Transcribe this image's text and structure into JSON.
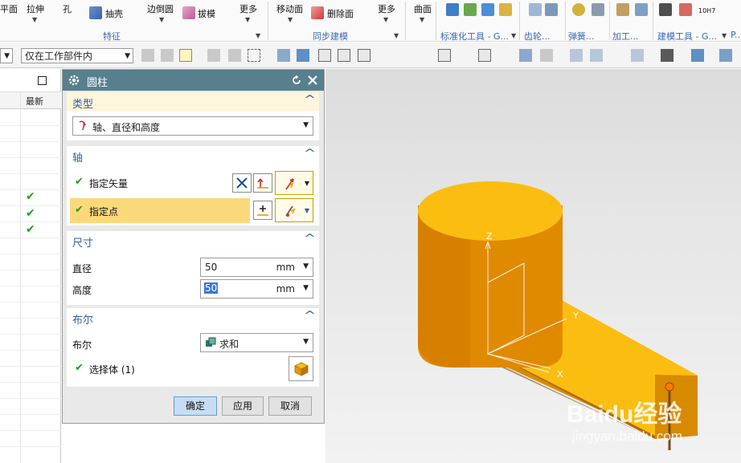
{
  "ribbon": {
    "items": [
      {
        "label": "平面"
      },
      {
        "label": "拉伸"
      },
      {
        "label": "孔"
      },
      {
        "label": "抽壳"
      },
      {
        "label": "边倒圆"
      },
      {
        "label": "拔模"
      },
      {
        "label": "更多"
      },
      {
        "label": "移动面"
      },
      {
        "label": "删除面"
      },
      {
        "label": "更多"
      },
      {
        "label": "曲面"
      }
    ],
    "groups": {
      "feature": "特征",
      "sync": "同步建模",
      "std_tools": "标准化工具 - G...",
      "gear": "齿轮...",
      "spring": "弹簧...",
      "machining": "加工...",
      "build_tools": "建模工具 - G...",
      "more": "P..."
    },
    "tolerance_icon_text": "10H7"
  },
  "toolbar2": {
    "scope_select": "仅在工作部件内"
  },
  "navigator": {
    "column_header": "最新",
    "checks": [
      "✔",
      "✔",
      "✔"
    ]
  },
  "dialog": {
    "title": "圆柱",
    "type_section": {
      "title": "类型",
      "selected_type": "轴、直径和高度"
    },
    "axis_section": {
      "title": "轴",
      "specify_vector": "指定矢量",
      "specify_point": "指定点"
    },
    "size_section": {
      "title": "尺寸",
      "diameter_label": "直径",
      "diameter_value": "50",
      "diameter_unit": "mm",
      "height_label": "高度",
      "height_value": "50",
      "height_unit": "mm"
    },
    "boolean_section": {
      "title": "布尔",
      "boolean_label": "布尔",
      "boolean_value": "求和",
      "select_body": "选择体 (1)"
    },
    "buttons": {
      "ok": "确定",
      "apply": "应用",
      "cancel": "取消"
    }
  },
  "viewport": {
    "axis_labels": {
      "z": "Z",
      "y": "Y",
      "x": "X"
    },
    "watermark_brand": "Baidu经验",
    "watermark_url": "jingyan.baidu.com",
    "colors": {
      "solid_top": "#fbbd10",
      "solid_side": "#d58a00",
      "solid_dark": "#b06a00",
      "title_bar": "#587f8e",
      "check": "#1aa31a"
    }
  }
}
